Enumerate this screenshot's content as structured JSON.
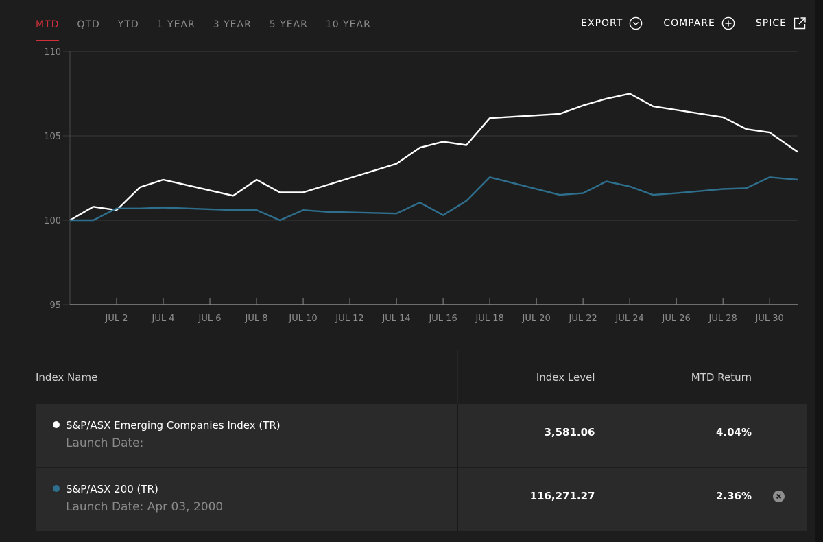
{
  "tabs": [
    {
      "label": "MTD",
      "active": true
    },
    {
      "label": "QTD",
      "active": false
    },
    {
      "label": "YTD",
      "active": false
    },
    {
      "label": "1 YEAR",
      "active": false
    },
    {
      "label": "3 YEAR",
      "active": false
    },
    {
      "label": "5 YEAR",
      "active": false
    },
    {
      "label": "10 YEAR",
      "active": false
    }
  ],
  "actions": {
    "export_label": "EXPORT",
    "compare_label": "COMPARE",
    "spice_label": "SPICE"
  },
  "colors": {
    "accent": "#d0303a",
    "series1": "#ffffff",
    "series2": "#2f6f8e",
    "grid": "#3c3c3c"
  },
  "chart_data": {
    "type": "line",
    "x_tick_labels": [
      "JUL 2",
      "JUL 4",
      "JUL 6",
      "JUL 8",
      "JUL 10",
      "JUL 12",
      "JUL 14",
      "JUL 16",
      "JUL 18",
      "JUL 20",
      "JUL 22",
      "JUL 24",
      "JUL 26",
      "JUL 28",
      "JUL 30"
    ],
    "x_tick_values": [
      2,
      4,
      6,
      8,
      10,
      12,
      14,
      16,
      18,
      20,
      22,
      24,
      26,
      28,
      30
    ],
    "xlim": [
      0,
      31.2
    ],
    "y_ticks": [
      95,
      100,
      105,
      110
    ],
    "ylim": [
      95,
      110
    ],
    "grid": true,
    "series": [
      {
        "name": "S&P/ASX Emerging Companies Index (TR)",
        "color": "#ffffff",
        "x": [
          0,
          1,
          2,
          3,
          4,
          7,
          8,
          9,
          10,
          14,
          15,
          16,
          17,
          18,
          21,
          22,
          23,
          24,
          25,
          28,
          29,
          30,
          31.2
        ],
        "y": [
          100.0,
          100.8,
          100.6,
          101.95,
          102.4,
          101.45,
          102.4,
          101.65,
          101.65,
          103.35,
          104.3,
          104.65,
          104.45,
          106.05,
          106.3,
          106.8,
          107.2,
          107.5,
          106.75,
          106.1,
          105.4,
          105.2,
          104.05
        ]
      },
      {
        "name": "S&P/ASX 200 (TR)",
        "color": "#2f6f8e",
        "x": [
          0,
          1,
          2,
          3,
          4,
          7,
          8,
          9,
          10,
          11,
          14,
          15,
          16,
          17,
          18,
          21,
          22,
          23,
          24,
          25,
          26,
          28,
          29,
          30,
          31.2
        ],
        "y": [
          100.0,
          100.0,
          100.7,
          100.7,
          100.75,
          100.6,
          100.6,
          100.0,
          100.6,
          100.5,
          100.4,
          101.05,
          100.3,
          101.15,
          102.55,
          101.5,
          101.6,
          102.3,
          102.0,
          101.5,
          101.6,
          101.85,
          101.9,
          102.55,
          102.4
        ]
      }
    ]
  },
  "table": {
    "headers": {
      "name": "Index Name",
      "level": "Index Level",
      "return": "MTD Return"
    },
    "rows": [
      {
        "name": "S&P/ASX Emerging Companies Index (TR)",
        "launch": "Launch Date:",
        "level": "3,581.06",
        "return": "4.04%",
        "color": "#ffffff",
        "removable": false
      },
      {
        "name": "S&P/ASX 200 (TR)",
        "launch": "Launch Date: Apr 03, 2000",
        "level": "116,271.27",
        "return": "2.36%",
        "color": "#2f6f8e",
        "removable": true
      }
    ]
  }
}
